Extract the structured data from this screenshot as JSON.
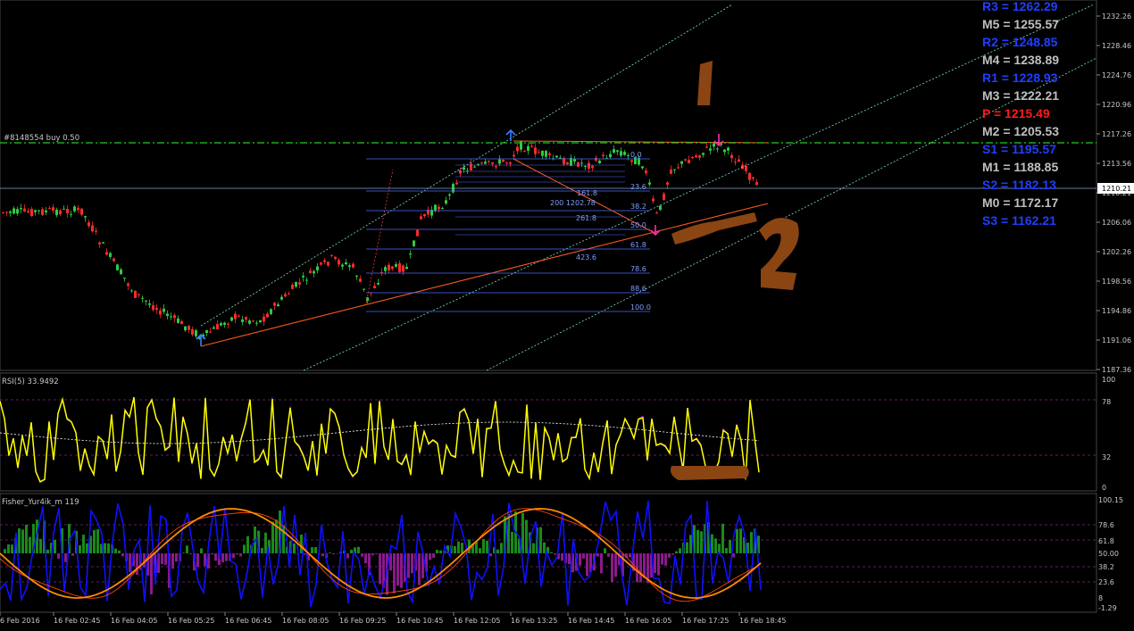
{
  "colors": {
    "background": "#000000",
    "bull": "#2ecc40",
    "bear": "#ff2a2a",
    "grid": "#333333",
    "trade_line": "#22cc22",
    "channel": "#7fe0c8",
    "fib": "#4a6cff",
    "rsi": "#ffff00",
    "fisher_hist_up": "#1a8a1a",
    "fisher_hist_down": "#8a1a8a",
    "fisher_blue": "#1010ff",
    "fisher_orange": "#ff8c00",
    "annotation_brown": "#8b4513"
  },
  "trade_label": "#8148554 buy 0.50",
  "current_price": "1210.21",
  "price_axis": {
    "ticks": [
      "1232.26",
      "1228.46",
      "1224.76",
      "1220.96",
      "1217.26",
      "1213.56",
      "1210.21",
      "1206.06",
      "1202.26",
      "1198.56",
      "1194.86",
      "1191.06",
      "1187.36"
    ]
  },
  "pivots": [
    {
      "label": "R3 = 1262.29",
      "color": "#1f3fff"
    },
    {
      "label": "M5 = 1255.57",
      "color": "#bfbfbf"
    },
    {
      "label": "R2 = 1248.85",
      "color": "#1f3fff"
    },
    {
      "label": "M4 = 1238.89",
      "color": "#bfbfbf"
    },
    {
      "label": "R1 = 1228.93",
      "color": "#1f3fff"
    },
    {
      "label": "M3 = 1222.21",
      "color": "#bfbfbf"
    },
    {
      "label": "P  = 1215.49",
      "color": "#ff1a1a"
    },
    {
      "label": "M2 = 1205.53",
      "color": "#bfbfbf"
    },
    {
      "label": "S1 = 1195.57",
      "color": "#1f3fff"
    },
    {
      "label": "M1 = 1188.85",
      "color": "#bfbfbf"
    },
    {
      "label": "S2 = 1182.13",
      "color": "#1f3fff"
    },
    {
      "label": "M0 = 1172.17",
      "color": "#bfbfbf"
    },
    {
      "label": "S3 = 1162.21",
      "color": "#1f3fff"
    }
  ],
  "fib_levels": [
    "0.0",
    "23.6",
    "38.2",
    "50.0",
    "61.8",
    "78.6",
    "88.6",
    "100.0"
  ],
  "fib_ext": [
    "161.8",
    "200 1202.78",
    "261.8",
    "423.6"
  ],
  "rsi": {
    "label": "RSI(5) 33.9492",
    "ticks": [
      "100",
      "78",
      "32",
      "0"
    ]
  },
  "fisher": {
    "label": "Fisher_Yur4ik_m 119",
    "ticks": [
      "100.15",
      "78.6",
      "61.8",
      "50.00",
      "38.2",
      "23.6",
      "8",
      "-1.29"
    ]
  },
  "time_axis": [
    "6 Feb 2016",
    "16 Feb 02:45",
    "16 Feb 04:05",
    "16 Feb 05:25",
    "16 Feb 06:45",
    "16 Feb 08:05",
    "16 Feb 09:25",
    "16 Feb 10:45",
    "16 Feb 12:05",
    "16 Feb 13:25",
    "16 Feb 14:45",
    "16 Feb 16:05",
    "16 Feb 17:25",
    "16 Feb 18:45"
  ],
  "annotations": [
    "1",
    "2"
  ]
}
